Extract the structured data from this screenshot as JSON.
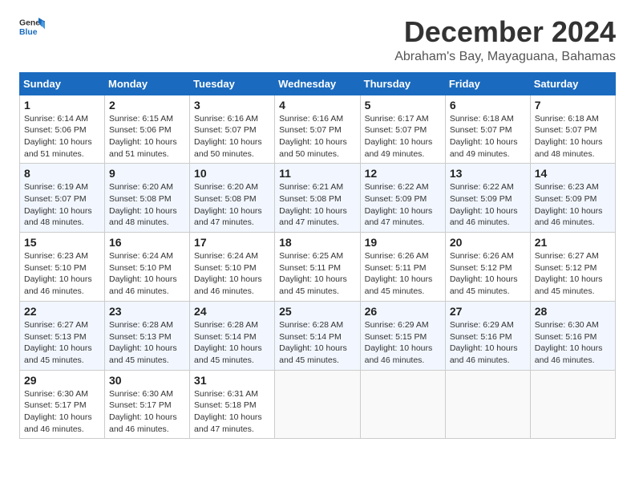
{
  "logo": {
    "text_general": "General",
    "text_blue": "Blue"
  },
  "header": {
    "month": "December 2024",
    "location": "Abraham's Bay, Mayaguana, Bahamas"
  },
  "weekdays": [
    "Sunday",
    "Monday",
    "Tuesday",
    "Wednesday",
    "Thursday",
    "Friday",
    "Saturday"
  ],
  "weeks": [
    [
      {
        "day": "1",
        "sunrise": "Sunrise: 6:14 AM",
        "sunset": "Sunset: 5:06 PM",
        "daylight": "Daylight: 10 hours and 51 minutes."
      },
      {
        "day": "2",
        "sunrise": "Sunrise: 6:15 AM",
        "sunset": "Sunset: 5:06 PM",
        "daylight": "Daylight: 10 hours and 51 minutes."
      },
      {
        "day": "3",
        "sunrise": "Sunrise: 6:16 AM",
        "sunset": "Sunset: 5:07 PM",
        "daylight": "Daylight: 10 hours and 50 minutes."
      },
      {
        "day": "4",
        "sunrise": "Sunrise: 6:16 AM",
        "sunset": "Sunset: 5:07 PM",
        "daylight": "Daylight: 10 hours and 50 minutes."
      },
      {
        "day": "5",
        "sunrise": "Sunrise: 6:17 AM",
        "sunset": "Sunset: 5:07 PM",
        "daylight": "Daylight: 10 hours and 49 minutes."
      },
      {
        "day": "6",
        "sunrise": "Sunrise: 6:18 AM",
        "sunset": "Sunset: 5:07 PM",
        "daylight": "Daylight: 10 hours and 49 minutes."
      },
      {
        "day": "7",
        "sunrise": "Sunrise: 6:18 AM",
        "sunset": "Sunset: 5:07 PM",
        "daylight": "Daylight: 10 hours and 48 minutes."
      }
    ],
    [
      {
        "day": "8",
        "sunrise": "Sunrise: 6:19 AM",
        "sunset": "Sunset: 5:07 PM",
        "daylight": "Daylight: 10 hours and 48 minutes."
      },
      {
        "day": "9",
        "sunrise": "Sunrise: 6:20 AM",
        "sunset": "Sunset: 5:08 PM",
        "daylight": "Daylight: 10 hours and 48 minutes."
      },
      {
        "day": "10",
        "sunrise": "Sunrise: 6:20 AM",
        "sunset": "Sunset: 5:08 PM",
        "daylight": "Daylight: 10 hours and 47 minutes."
      },
      {
        "day": "11",
        "sunrise": "Sunrise: 6:21 AM",
        "sunset": "Sunset: 5:08 PM",
        "daylight": "Daylight: 10 hours and 47 minutes."
      },
      {
        "day": "12",
        "sunrise": "Sunrise: 6:22 AM",
        "sunset": "Sunset: 5:09 PM",
        "daylight": "Daylight: 10 hours and 47 minutes."
      },
      {
        "day": "13",
        "sunrise": "Sunrise: 6:22 AM",
        "sunset": "Sunset: 5:09 PM",
        "daylight": "Daylight: 10 hours and 46 minutes."
      },
      {
        "day": "14",
        "sunrise": "Sunrise: 6:23 AM",
        "sunset": "Sunset: 5:09 PM",
        "daylight": "Daylight: 10 hours and 46 minutes."
      }
    ],
    [
      {
        "day": "15",
        "sunrise": "Sunrise: 6:23 AM",
        "sunset": "Sunset: 5:10 PM",
        "daylight": "Daylight: 10 hours and 46 minutes."
      },
      {
        "day": "16",
        "sunrise": "Sunrise: 6:24 AM",
        "sunset": "Sunset: 5:10 PM",
        "daylight": "Daylight: 10 hours and 46 minutes."
      },
      {
        "day": "17",
        "sunrise": "Sunrise: 6:24 AM",
        "sunset": "Sunset: 5:10 PM",
        "daylight": "Daylight: 10 hours and 46 minutes."
      },
      {
        "day": "18",
        "sunrise": "Sunrise: 6:25 AM",
        "sunset": "Sunset: 5:11 PM",
        "daylight": "Daylight: 10 hours and 45 minutes."
      },
      {
        "day": "19",
        "sunrise": "Sunrise: 6:26 AM",
        "sunset": "Sunset: 5:11 PM",
        "daylight": "Daylight: 10 hours and 45 minutes."
      },
      {
        "day": "20",
        "sunrise": "Sunrise: 6:26 AM",
        "sunset": "Sunset: 5:12 PM",
        "daylight": "Daylight: 10 hours and 45 minutes."
      },
      {
        "day": "21",
        "sunrise": "Sunrise: 6:27 AM",
        "sunset": "Sunset: 5:12 PM",
        "daylight": "Daylight: 10 hours and 45 minutes."
      }
    ],
    [
      {
        "day": "22",
        "sunrise": "Sunrise: 6:27 AM",
        "sunset": "Sunset: 5:13 PM",
        "daylight": "Daylight: 10 hours and 45 minutes."
      },
      {
        "day": "23",
        "sunrise": "Sunrise: 6:28 AM",
        "sunset": "Sunset: 5:13 PM",
        "daylight": "Daylight: 10 hours and 45 minutes."
      },
      {
        "day": "24",
        "sunrise": "Sunrise: 6:28 AM",
        "sunset": "Sunset: 5:14 PM",
        "daylight": "Daylight: 10 hours and 45 minutes."
      },
      {
        "day": "25",
        "sunrise": "Sunrise: 6:28 AM",
        "sunset": "Sunset: 5:14 PM",
        "daylight": "Daylight: 10 hours and 45 minutes."
      },
      {
        "day": "26",
        "sunrise": "Sunrise: 6:29 AM",
        "sunset": "Sunset: 5:15 PM",
        "daylight": "Daylight: 10 hours and 46 minutes."
      },
      {
        "day": "27",
        "sunrise": "Sunrise: 6:29 AM",
        "sunset": "Sunset: 5:16 PM",
        "daylight": "Daylight: 10 hours and 46 minutes."
      },
      {
        "day": "28",
        "sunrise": "Sunrise: 6:30 AM",
        "sunset": "Sunset: 5:16 PM",
        "daylight": "Daylight: 10 hours and 46 minutes."
      }
    ],
    [
      {
        "day": "29",
        "sunrise": "Sunrise: 6:30 AM",
        "sunset": "Sunset: 5:17 PM",
        "daylight": "Daylight: 10 hours and 46 minutes."
      },
      {
        "day": "30",
        "sunrise": "Sunrise: 6:30 AM",
        "sunset": "Sunset: 5:17 PM",
        "daylight": "Daylight: 10 hours and 46 minutes."
      },
      {
        "day": "31",
        "sunrise": "Sunrise: 6:31 AM",
        "sunset": "Sunset: 5:18 PM",
        "daylight": "Daylight: 10 hours and 47 minutes."
      },
      null,
      null,
      null,
      null
    ]
  ]
}
